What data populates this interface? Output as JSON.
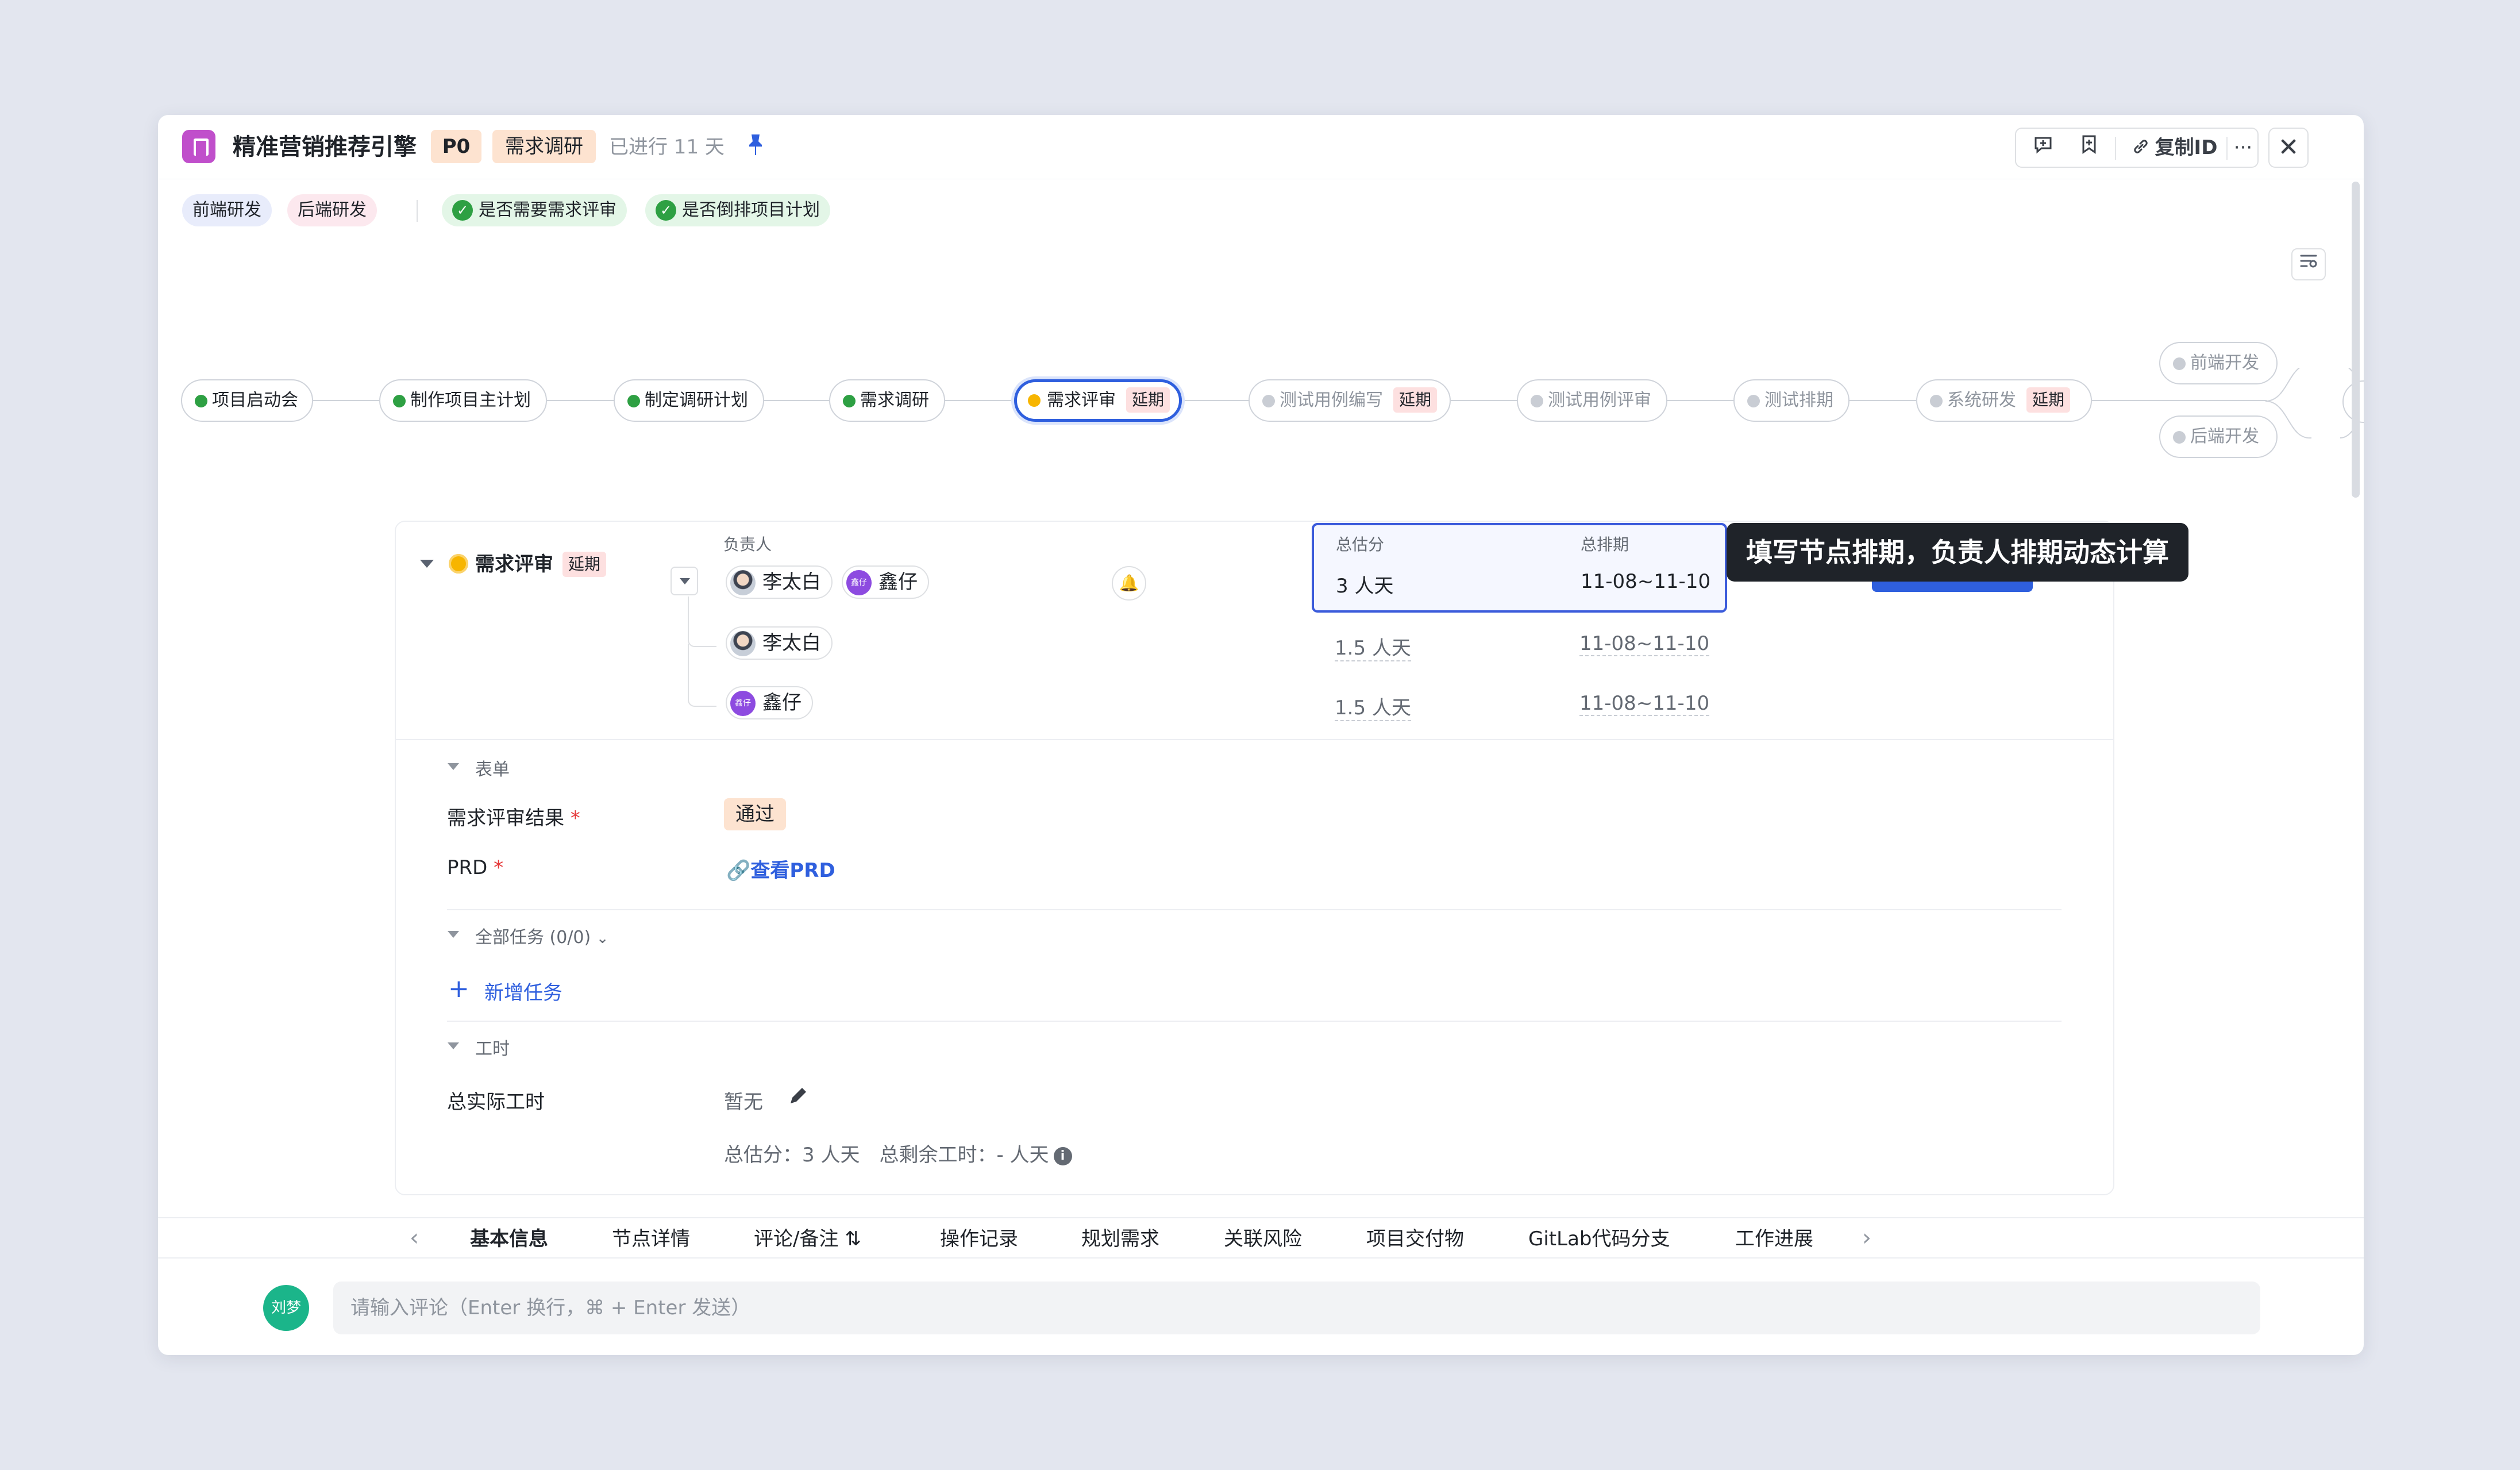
{
  "header": {
    "title": "精准营销推荐引擎",
    "priority": "P0",
    "stage": "需求调研",
    "elapsed": "已进行 11 天",
    "copy_id_label": "复制ID",
    "more_label": "···",
    "close_label": "✕"
  },
  "tags": {
    "team_front": "前端研发",
    "team_back": "后端研发",
    "check_review": "是否需要需求评审",
    "check_plan": "是否倒排项目计划"
  },
  "flow": {
    "delay_label": "延期",
    "nodes": [
      {
        "label": "项目启动会",
        "status": "done"
      },
      {
        "label": "制作项目主计划",
        "status": "done"
      },
      {
        "label": "制定调研计划",
        "status": "done"
      },
      {
        "label": "需求调研",
        "status": "done"
      },
      {
        "label": "需求评审",
        "status": "active",
        "delayed": true
      },
      {
        "label": "测试用例编写",
        "status": "todo",
        "delayed": true
      },
      {
        "label": "测试用例评审",
        "status": "todo"
      },
      {
        "label": "测试排期",
        "status": "todo"
      },
      {
        "label": "系统研发",
        "status": "todo",
        "delayed": true
      },
      {
        "label": "前端开发",
        "status": "todo"
      },
      {
        "label": "后端开发",
        "status": "todo"
      }
    ]
  },
  "detail": {
    "node_name": "需求评审",
    "delay_label": "延期",
    "owner_header": "负责人",
    "estimate_header": "总估分",
    "schedule_header": "总排期",
    "owners": [
      "李太白",
      "鑫仔"
    ],
    "avatar_small_text": "鑫仔",
    "total_estimate": "3 人天",
    "total_schedule": "11-08~11-10",
    "sub_rows": [
      {
        "name": "李太白",
        "estimate": "1.5 人天",
        "schedule": "11-08~11-10"
      },
      {
        "name": "鑫仔",
        "estimate": "1.5 人天",
        "schedule": "11-08~11-10"
      }
    ],
    "tooltip": "填写节点排期，负责人排期动态计算",
    "form_section": "表单",
    "review_result_label": "需求评审结果",
    "review_result_value": "通过",
    "prd_label": "PRD",
    "prd_link": "查看PRD",
    "required_mark": "*",
    "tasks_section": "全部任务 (0/0)",
    "add_task": "新增任务",
    "worktime_section": "工时",
    "actual_worktime_label": "总实际工时",
    "actual_worktime_value": "暂无",
    "summary": "总估分：3 人天　总剩余工时：- 人天"
  },
  "tabs": {
    "items": [
      "基本信息",
      "节点详情",
      "评论/备注",
      "操作记录",
      "规划需求",
      "关联风险",
      "项目交付物",
      "GitLab代码分支",
      "工作进展"
    ],
    "active": "基本信息"
  },
  "comment": {
    "avatar_text": "刘梦",
    "placeholder": "请输入评论（Enter 换行，⌘ + Enter 发送）"
  }
}
